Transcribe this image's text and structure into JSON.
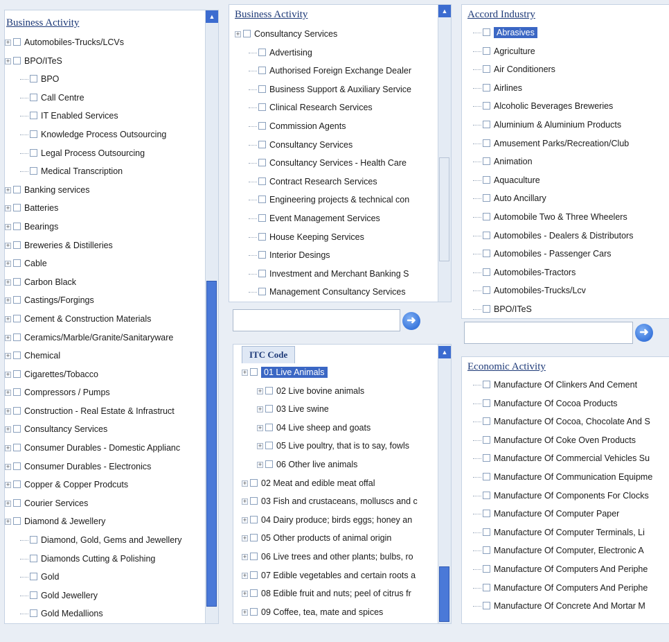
{
  "panels": {
    "left": {
      "title": "Business Activity",
      "items": [
        {
          "label": "Automobiles-Trucks/LCVs",
          "level": 0,
          "exp": true
        },
        {
          "label": "BPO/ITeS",
          "level": 0,
          "exp": true
        },
        {
          "label": "BPO",
          "level": 1
        },
        {
          "label": "Call Centre",
          "level": 1
        },
        {
          "label": "IT Enabled Services",
          "level": 1
        },
        {
          "label": "Knowledge Process Outsourcing",
          "level": 1
        },
        {
          "label": "Legal Process Outsourcing",
          "level": 1
        },
        {
          "label": "Medical Transcription",
          "level": 1
        },
        {
          "label": "Banking services",
          "level": 0,
          "exp": true
        },
        {
          "label": "Batteries",
          "level": 0,
          "exp": true
        },
        {
          "label": "Bearings",
          "level": 0,
          "exp": true
        },
        {
          "label": "Breweries & Distilleries",
          "level": 0,
          "exp": true
        },
        {
          "label": "Cable",
          "level": 0,
          "exp": true
        },
        {
          "label": "Carbon Black",
          "level": 0,
          "exp": true
        },
        {
          "label": "Castings/Forgings",
          "level": 0,
          "exp": true
        },
        {
          "label": "Cement & Construction Materials",
          "level": 0,
          "exp": true
        },
        {
          "label": "Ceramics/Marble/Granite/Sanitaryware",
          "level": 0,
          "exp": true
        },
        {
          "label": "Chemical",
          "level": 0,
          "exp": true
        },
        {
          "label": "Cigarettes/Tobacco",
          "level": 0,
          "exp": true
        },
        {
          "label": "Compressors / Pumps",
          "level": 0,
          "exp": true
        },
        {
          "label": "Construction - Real Estate & Infrastruct",
          "level": 0,
          "exp": true
        },
        {
          "label": "Consultancy Services",
          "level": 0,
          "exp": true
        },
        {
          "label": "Consumer Durables - Domestic Applianc",
          "level": 0,
          "exp": true
        },
        {
          "label": "Consumer Durables - Electronics",
          "level": 0,
          "exp": true
        },
        {
          "label": "Copper & Copper Prodcuts",
          "level": 0,
          "exp": true
        },
        {
          "label": "Courier Services",
          "level": 0,
          "exp": true
        },
        {
          "label": "Diamond & Jewellery",
          "level": 0,
          "exp": true
        },
        {
          "label": "Diamond, Gold, Gems and Jewellery",
          "level": 1
        },
        {
          "label": "Diamonds Cutting & Polishing",
          "level": 1
        },
        {
          "label": "Gold",
          "level": 1
        },
        {
          "label": "Gold Jewellery",
          "level": 1
        },
        {
          "label": "Gold Medallions",
          "level": 1
        }
      ]
    },
    "middle_top": {
      "title": "Business Activity",
      "items": [
        {
          "label": "Consultancy Services",
          "level": 0,
          "exp": true
        },
        {
          "label": "Advertising",
          "level": 1
        },
        {
          "label": "Authorised Foreign Exchange Dealer",
          "level": 1
        },
        {
          "label": "Business Support & Auxiliary Service",
          "level": 1
        },
        {
          "label": "Clinical Research Services",
          "level": 1
        },
        {
          "label": "Commission Agents",
          "level": 1
        },
        {
          "label": "Consultancy Services",
          "level": 1
        },
        {
          "label": "Consultancy Services - Health Care",
          "level": 1
        },
        {
          "label": "Contract Research Services",
          "level": 1
        },
        {
          "label": "Engineering projects & technical con",
          "level": 1
        },
        {
          "label": "Event Management Services",
          "level": 1
        },
        {
          "label": "House Keeping Services",
          "level": 1
        },
        {
          "label": "Interior Desings",
          "level": 1
        },
        {
          "label": "Investment and Merchant Banking S",
          "level": 1
        },
        {
          "label": "Management Consultancy Services",
          "level": 1
        }
      ],
      "search_value": ""
    },
    "middle_bottom": {
      "tab": "ITC Code",
      "items": [
        {
          "label": "01 Live Animals",
          "level": 0,
          "exp": true,
          "selected": true
        },
        {
          "label": "02 Live bovine animals",
          "level": 1,
          "exp": true
        },
        {
          "label": "03 Live swine",
          "level": 1,
          "exp": true
        },
        {
          "label": "04 Live sheep and goats",
          "level": 1,
          "exp": true
        },
        {
          "label": "05 Live poultry, that is to say, fowls",
          "level": 1,
          "exp": true
        },
        {
          "label": "06 Other live animals",
          "level": 1,
          "exp": true
        },
        {
          "label": "02 Meat and edible meat offal",
          "level": 0,
          "exp": true
        },
        {
          "label": "03 Fish and crustaceans, molluscs and c",
          "level": 0,
          "exp": true
        },
        {
          "label": "04 Dairy produce; birds eggs; honey an",
          "level": 0,
          "exp": true
        },
        {
          "label": "05 Other products of animal origin",
          "level": 0,
          "exp": true
        },
        {
          "label": "06 Live trees and other plants; bulbs, ro",
          "level": 0,
          "exp": true
        },
        {
          "label": "07 Edible vegetables and certain roots a",
          "level": 0,
          "exp": true
        },
        {
          "label": "08 Edible fruit and nuts; peel of citrus fr",
          "level": 0,
          "exp": true
        },
        {
          "label": "09 Coffee, tea, mate and spices",
          "level": 0,
          "exp": true
        }
      ]
    },
    "right_top": {
      "title": "Accord Industry",
      "items": [
        {
          "label": "Abrasives",
          "selected": true
        },
        {
          "label": "Agriculture"
        },
        {
          "label": "Air Conditioners"
        },
        {
          "label": "Airlines"
        },
        {
          "label": "Alcoholic  Beverages  Breweries"
        },
        {
          "label": "Aluminium & Aluminium Products"
        },
        {
          "label": "Amusement Parks/Recreation/Club"
        },
        {
          "label": "Animation"
        },
        {
          "label": "Aquaculture"
        },
        {
          "label": "Auto Ancillary"
        },
        {
          "label": "Automobile Two & Three Wheelers"
        },
        {
          "label": "Automobiles - Dealers & Distributors"
        },
        {
          "label": "Automobiles - Passenger Cars"
        },
        {
          "label": "Automobiles-Tractors"
        },
        {
          "label": "Automobiles-Trucks/Lcv"
        },
        {
          "label": "BPO/ITeS"
        }
      ],
      "search_value": ""
    },
    "right_bottom": {
      "title": "Economic Activity",
      "items": [
        {
          "label": "Manufacture Of Clinkers And Cement"
        },
        {
          "label": "Manufacture Of Cocoa Products"
        },
        {
          "label": "Manufacture Of Cocoa, Chocolate And S"
        },
        {
          "label": "Manufacture Of Coke Oven Products"
        },
        {
          "label": "Manufacture Of Commercial Vehicles Su"
        },
        {
          "label": "Manufacture Of Communication Equipme"
        },
        {
          "label": "Manufacture Of Components For Clocks"
        },
        {
          "label": "Manufacture Of Computer Paper"
        },
        {
          "label": "Manufacture Of Computer Terminals, Li"
        },
        {
          "label": "Manufacture Of Computer, Electronic A"
        },
        {
          "label": "Manufacture Of Computers And Periphe"
        },
        {
          "label": "Manufacture Of Computers And Periphe"
        },
        {
          "label": "Manufacture Of Concrete And Mortar M"
        }
      ]
    }
  },
  "icons": {
    "go": "arrow-right-circle-icon",
    "expand": "plus-box-icon",
    "checkbox": "checkbox-icon"
  }
}
